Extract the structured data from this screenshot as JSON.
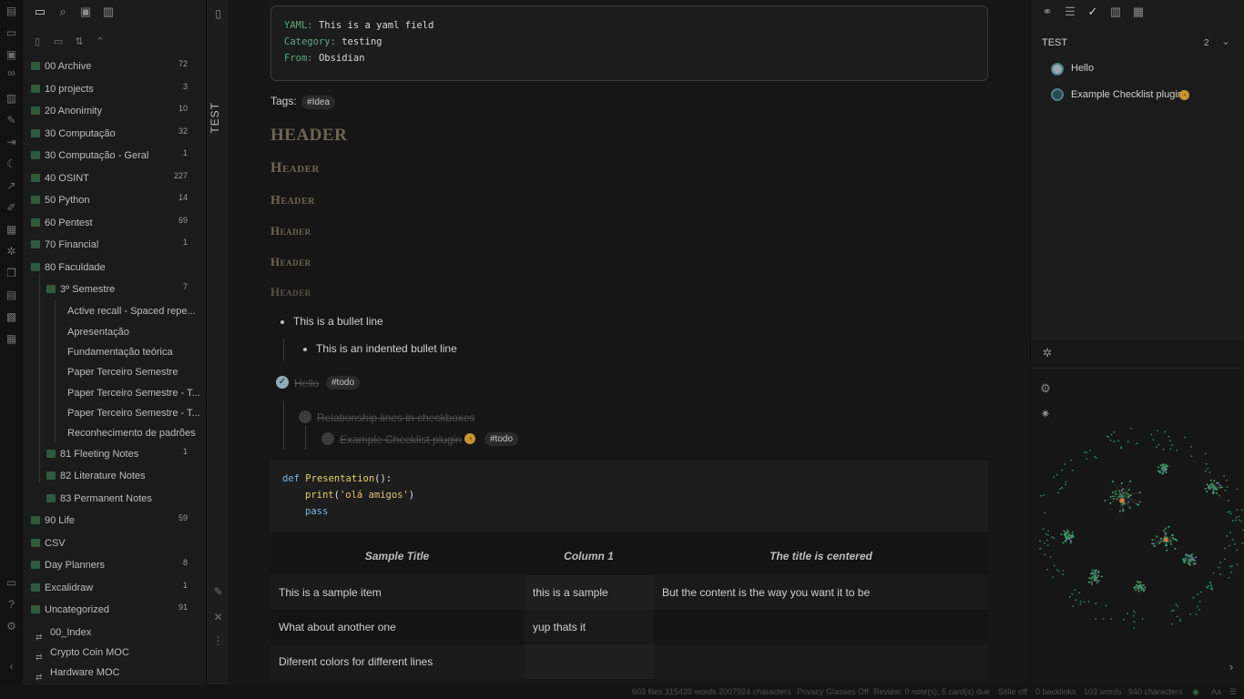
{
  "explorer": {
    "items": [
      {
        "label": "00 Archive",
        "count": "72"
      },
      {
        "label": "10 projects",
        "count": "3"
      },
      {
        "label": "20 Anonimity",
        "count": "10"
      },
      {
        "label": "30 Computação",
        "count": "32"
      },
      {
        "label": "30 Computação - Geral",
        "count": "1"
      },
      {
        "label": "40 OSINT",
        "count": "227"
      },
      {
        "label": "50 Python",
        "count": "14"
      },
      {
        "label": "60 Pentest",
        "count": "69"
      },
      {
        "label": "70 Financial",
        "count": "1"
      },
      {
        "label": "80 Faculdade",
        "count": ""
      },
      {
        "label": "3º Semestre",
        "count": "7"
      },
      {
        "label": "Active recall - Spaced repe...",
        "count": ""
      },
      {
        "label": "Apresentação",
        "count": ""
      },
      {
        "label": "Fundamentação teórica",
        "count": ""
      },
      {
        "label": "Paper Terceiro Semestre",
        "count": ""
      },
      {
        "label": "Paper Terceiro Semestre - T...",
        "count": ""
      },
      {
        "label": "Paper Terceiro Semestre - T...",
        "count": ""
      },
      {
        "label": "Reconhecimento de padrões",
        "count": ""
      },
      {
        "label": "81 Fleeting Notes",
        "count": "1"
      },
      {
        "label": "82 Literature Notes",
        "count": ""
      },
      {
        "label": "83 Permanent Notes",
        "count": ""
      },
      {
        "label": "90 Life",
        "count": "59"
      },
      {
        "label": "CSV",
        "count": ""
      },
      {
        "label": "Day Planners",
        "count": "8"
      },
      {
        "label": "Excalidraw",
        "count": "1"
      },
      {
        "label": "Uncategorized",
        "count": "91"
      },
      {
        "label": "00_Index",
        "count": ""
      },
      {
        "label": "Crypto Coin MOC",
        "count": ""
      },
      {
        "label": "Hardware MOC",
        "count": ""
      }
    ]
  },
  "strip": {
    "title": "TEST"
  },
  "note": {
    "yaml": [
      {
        "key": "YAML: ",
        "value": "This is a yaml field"
      },
      {
        "key": "Category: ",
        "value": "testing"
      },
      {
        "key": "From: ",
        "value": "Obsidian"
      }
    ],
    "tags_label": "Tags:",
    "tag": "#Idea",
    "headers": [
      "HEADER",
      "Header",
      "Header",
      "Header",
      "Header",
      "Header"
    ],
    "bullet1": "This is a bullet line",
    "bullet2": "This is an indented bullet line",
    "task1": "Hello",
    "task1_tag": "#todo",
    "task2": "Relationship lines in checkboxes",
    "task3": "Example Checklist plugin",
    "task3_tag": "#todo",
    "code": {
      "l1_kw": "def ",
      "l1_fn": "Presentation",
      "l1_rest": "():",
      "l2_fn": "print",
      "l2_p1": "(",
      "l2_str": "'olá amigos'",
      "l2_p2": ")",
      "l3_kw": "pass"
    },
    "table": {
      "headers": [
        "Sample Title",
        "Column 1",
        "The title is centered"
      ],
      "rows": [
        [
          "This is a sample item",
          "this is a sample",
          "But the content is the way you want it to be"
        ],
        [
          "What about another one",
          "yup thats it",
          ""
        ],
        [
          "Diferent colors for different lines",
          "",
          ""
        ]
      ]
    }
  },
  "right": {
    "section_title": "TEST",
    "section_count": "2",
    "tasks": [
      "Hello",
      "Example Checklist plugin"
    ]
  },
  "status": {
    "files": "603 files 315439 words 2007924 characters",
    "privacy": "Privacy Glasses Off",
    "review": "Review: 0 note(s), 5 card(s) due",
    "stille": "Stille off",
    "backlinks": "0 backlinks",
    "words": "103 words",
    "chars": "940 characters",
    "font": "Aa"
  }
}
